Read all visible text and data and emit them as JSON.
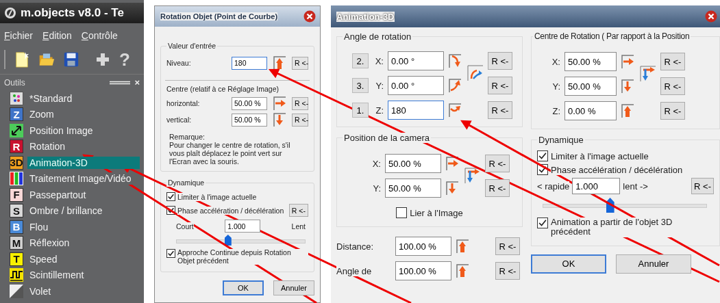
{
  "tool_window": {
    "title": "m.objects v8.0 - Te",
    "menu": [
      "Fichier",
      "Edition",
      "Contrôle"
    ],
    "toolbar_help": "?",
    "panel_title": "Outils",
    "panel_close": "×",
    "items": [
      {
        "label": "*Standard",
        "kind": "standard",
        "selected": false
      },
      {
        "label": "Zoom",
        "kind": "letter",
        "icon_text": "Z",
        "color": "#3f74c8",
        "selected": false
      },
      {
        "label": "Position Image",
        "kind": "move",
        "selected": false
      },
      {
        "label": "Rotation",
        "kind": "letter",
        "icon_text": "R",
        "color": "#c8102e",
        "selected": false
      },
      {
        "label": "Animation-3D",
        "kind": "letter",
        "icon_text": "3D",
        "color": "#f0a020",
        "selected": true
      },
      {
        "label": "Traitement Image/Vidéo",
        "kind": "bars",
        "selected": false
      },
      {
        "label": "Passepartout",
        "kind": "letter",
        "icon_text": "F",
        "color": "#f8d8d8",
        "selected": false
      },
      {
        "label": "Ombre / brillance",
        "kind": "letter",
        "icon_text": "S",
        "color": "#d8d8d8",
        "selected": false
      },
      {
        "label": "Flou",
        "kind": "letter",
        "icon_text": "B",
        "color": "#4a8ad8",
        "selected": false
      },
      {
        "label": "Réflexion",
        "kind": "letter",
        "icon_text": "M",
        "color": "#d0d0d0",
        "selected": false
      },
      {
        "label": "Speed",
        "kind": "letter",
        "icon_text": "T",
        "color": "#f8f000",
        "selected": false
      },
      {
        "label": "Scintillement",
        "kind": "wave",
        "selected": false
      },
      {
        "label": "Volet",
        "kind": "wipe",
        "selected": false
      }
    ]
  },
  "rotation_dialog": {
    "title": "Rotation Objet (Point de Courbe)",
    "input": {
      "legend": "Valeur d'entrée",
      "label": "Niveau:",
      "value": "180",
      "focused": true,
      "reset": "R <-"
    },
    "centre": {
      "legend": "Centre (relatif à ce Réglage Image)",
      "rows": [
        {
          "label": "horizontal:",
          "value": "50.00 %",
          "reset": "R <-"
        },
        {
          "label": "vertical:",
          "value": "50.00 %",
          "reset": "R <-"
        }
      ],
      "note": [
        "Remarque:",
        "Pour changer le centre de rotation, s'il",
        "vous plaît déplacez le point vert sur",
        "l'Ecran avec la souris."
      ]
    },
    "dynamics": {
      "legend": "Dynamique",
      "options": [
        {
          "label": "Limiter à l'image actuelle",
          "checked": true
        },
        {
          "label": "Phase accélération / décélération",
          "checked": true
        }
      ],
      "reset": "R <-",
      "min_label": "Court",
      "value": "1.000",
      "max_label": "Lent",
      "level": 0.4,
      "final_option": {
        "label": "Approche Continue depuis Rotation Objet précédent",
        "checked": true
      }
    },
    "buttons": [
      {
        "label": "OK",
        "default": true
      },
      {
        "label": "Annuler",
        "default": false
      }
    ]
  },
  "animation_dialog": {
    "title": "Animation-3D",
    "angle": {
      "legend": "Angle de rotation",
      "rows": [
        {
          "order": "2.",
          "axis": "X:",
          "value": "0.00 °",
          "focused": false,
          "reset": "R <-"
        },
        {
          "order": "3.",
          "axis": "Y:",
          "value": "0.00 °",
          "focused": false,
          "reset": "R <-"
        },
        {
          "order": "1.",
          "axis": "Z:",
          "value": "180",
          "focused": true,
          "reset": "R <-"
        }
      ]
    },
    "centre": {
      "legend": "Centre de Rotation ( Par rapport à la Position",
      "rows": [
        {
          "axis": "X:",
          "value": "50.00 %",
          "reset": "R <-"
        },
        {
          "axis": "Y:",
          "value": "50.00 %",
          "reset": "R <-"
        },
        {
          "axis": "Z:",
          "value": "0.00 %",
          "reset": "R <-"
        }
      ]
    },
    "camera": {
      "legend": "Position de la camera",
      "rows": [
        {
          "axis": "X:",
          "value": "50.00 %",
          "reset": "R <-"
        },
        {
          "axis": "Y:",
          "value": "50.00 %",
          "reset": "R <-"
        }
      ],
      "link": {
        "label": "Lier à l'Image",
        "checked": false
      }
    },
    "extra_rows": [
      {
        "label": "Distance:",
        "value": "100.00 %",
        "reset": "R <-"
      },
      {
        "label": "Angle de",
        "value": "100.00 %",
        "reset": "R <-"
      }
    ],
    "dynamics": {
      "legend": "Dynamique",
      "options": [
        {
          "label": "Limiter à l'image actuelle",
          "checked": true
        },
        {
          "label": "Phase accélération / décélération",
          "checked": true
        }
      ],
      "min_label": "< rapide",
      "value": "1.000",
      "max_label": "lent ->",
      "reset": "R <-",
      "level": 0.41,
      "final_option": {
        "label": "Animation a partir de l'objet 3D précédent",
        "checked": true
      }
    },
    "buttons": [
      {
        "label": "OK",
        "default": true
      },
      {
        "label": "Annuler",
        "default": false
      }
    ]
  }
}
